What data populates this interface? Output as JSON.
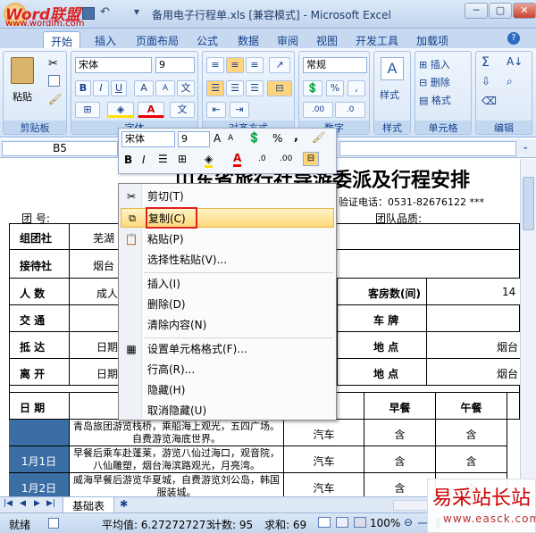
{
  "window": {
    "title": "备用电子行程单.xls  [兼容模式] - Microsoft Excel",
    "watermark_top_line1": "Word联盟",
    "watermark_top_line2": "www.wordlm.com",
    "watermark_bottom_line1": "易采站长站",
    "watermark_bottom_line2": "www.easck.com"
  },
  "tabs": [
    "开始",
    "插入",
    "页面布局",
    "公式",
    "数据",
    "审阅",
    "视图",
    "开发工具",
    "加载项"
  ],
  "ribbon": {
    "clipboard": {
      "label": "剪贴板",
      "paste": "粘贴"
    },
    "font": {
      "name": "宋体",
      "size": "9",
      "label": "字体"
    },
    "alignment": {
      "label": "对齐方式"
    },
    "number": {
      "format": "常规",
      "label": "数字"
    },
    "styles": {
      "label": "样式"
    },
    "cells": {
      "label": "单元格",
      "insert": "插入",
      "delete": "删除",
      "format": "格式"
    },
    "editing": {
      "label": "编辑"
    }
  },
  "formula_bar": {
    "name_box": "B5"
  },
  "mini_toolbar": {
    "font": "宋体",
    "size": "9"
  },
  "sheet": {
    "title": "山东省旅行社导游委派及行程安排",
    "verify_phone": "* 验证电话：0531-82676122 ***",
    "group_no_label": "团    号:",
    "group_quality_label": "团队品质:",
    "rows": {
      "zutuan_label": "组团社",
      "zutuan_val": "芜湖",
      "jiedai_label": "接待社",
      "jiedai_val": "烟台",
      "renshu_label": "人    数",
      "renshu_val": "成人",
      "kefang_label": "客房数(间)",
      "kefang_val": "14",
      "jiaotong_label": "交    通",
      "chepai_label": "车    牌",
      "didai_label": "抵    达",
      "didai_date": "日期",
      "didian1_label": "地    点",
      "didian1_val": "烟台",
      "likai_label": "离    开",
      "likai_date": "日期",
      "didian2_label": "地    点",
      "didian2_val": "烟台",
      "riqi_label": "日    期",
      "zaocan_label": "早餐",
      "wucan_label": "午餐"
    },
    "itinerary": [
      {
        "date": "",
        "text": "青岛旅团游览栈桥，乘船海上观光，五四广场。自费游览海底世界。",
        "transport": "汽车",
        "breakfast": "含",
        "lunch": "含"
      },
      {
        "date": "1月1日",
        "text": "早餐后乘车赴蓬莱，游览八仙过海口，观音院，八仙雕塑，烟台海滨路观光，月亮湾。",
        "transport": "汽车",
        "breakfast": "含",
        "lunch": "含"
      },
      {
        "date": "1月2日",
        "text": "威海早餐后游览华夏城，自费游览刘公岛，韩国服装城。",
        "transport": "汽车",
        "breakfast": "含",
        "lunch": "含"
      }
    ]
  },
  "context_menu": [
    {
      "label": "剪切(T)",
      "icon": "scissors-icon"
    },
    {
      "label": "复制(C)",
      "icon": "copy-icon",
      "highlighted": true
    },
    {
      "label": "粘贴(P)",
      "icon": "paste-icon"
    },
    {
      "label": "选择性粘贴(V)...",
      "icon": ""
    },
    {
      "label": "插入(I)",
      "icon": ""
    },
    {
      "label": "删除(D)",
      "icon": ""
    },
    {
      "label": "清除内容(N)",
      "icon": ""
    },
    {
      "label": "设置单元格格式(F)...",
      "icon": "format-cells-icon"
    },
    {
      "label": "行高(R)...",
      "icon": ""
    },
    {
      "label": "隐藏(H)",
      "icon": ""
    },
    {
      "label": "取消隐藏(U)",
      "icon": ""
    }
  ],
  "sheet_tab": "基础表",
  "status": {
    "ready": "就绪",
    "average": "平均值: 6.272727273",
    "count": "计数: 95",
    "sum": "求和: 69",
    "zoom": "100%"
  },
  "colors": {
    "highlight": "#ffe08a",
    "red_box": "#e02020",
    "ribbon_blue": "#15428b"
  }
}
